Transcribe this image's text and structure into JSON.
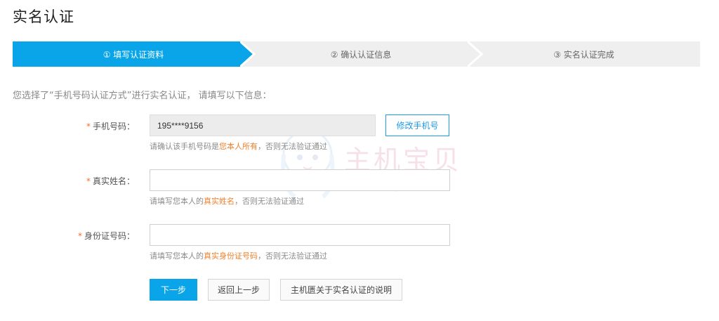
{
  "page": {
    "title": "实名认证"
  },
  "steps": [
    {
      "label": "① 填写认证资料",
      "active": true
    },
    {
      "label": "② 确认认证信息",
      "active": false
    },
    {
      "label": "③ 实名认证完成",
      "active": false
    }
  ],
  "intro": "您选择了“手机号码认证方式”进行实名认证， 请填写以下信息：",
  "form": {
    "required_mark": "*",
    "phone": {
      "label": "手机号码：",
      "value": "195****9156",
      "change_button": "修改手机号",
      "hint_prefix": "请确认该手机号码是",
      "hint_highlight": "您本人所有",
      "hint_suffix": "，否则无法验证通过"
    },
    "name": {
      "label": "真实姓名：",
      "value": "",
      "hint_prefix": "请填写您本人的",
      "hint_highlight": "真实姓名",
      "hint_suffix": "，否则无法验证通过"
    },
    "id_number": {
      "label": "身份证号码：",
      "value": "",
      "hint_prefix": "请填写您本人的",
      "hint_highlight": "真实身份证号码",
      "hint_suffix": "，否则无法验证通过"
    }
  },
  "actions": {
    "next": "下一步",
    "back": "返回上一步",
    "explain": "主机匮关于实名认证的说明"
  },
  "watermark": {
    "text": "主机宝贝",
    "url": "idcbaby.com"
  },
  "colors": {
    "accent": "#0aa5e8",
    "highlight": "#f0812c",
    "inactive_step": "#efefef"
  }
}
